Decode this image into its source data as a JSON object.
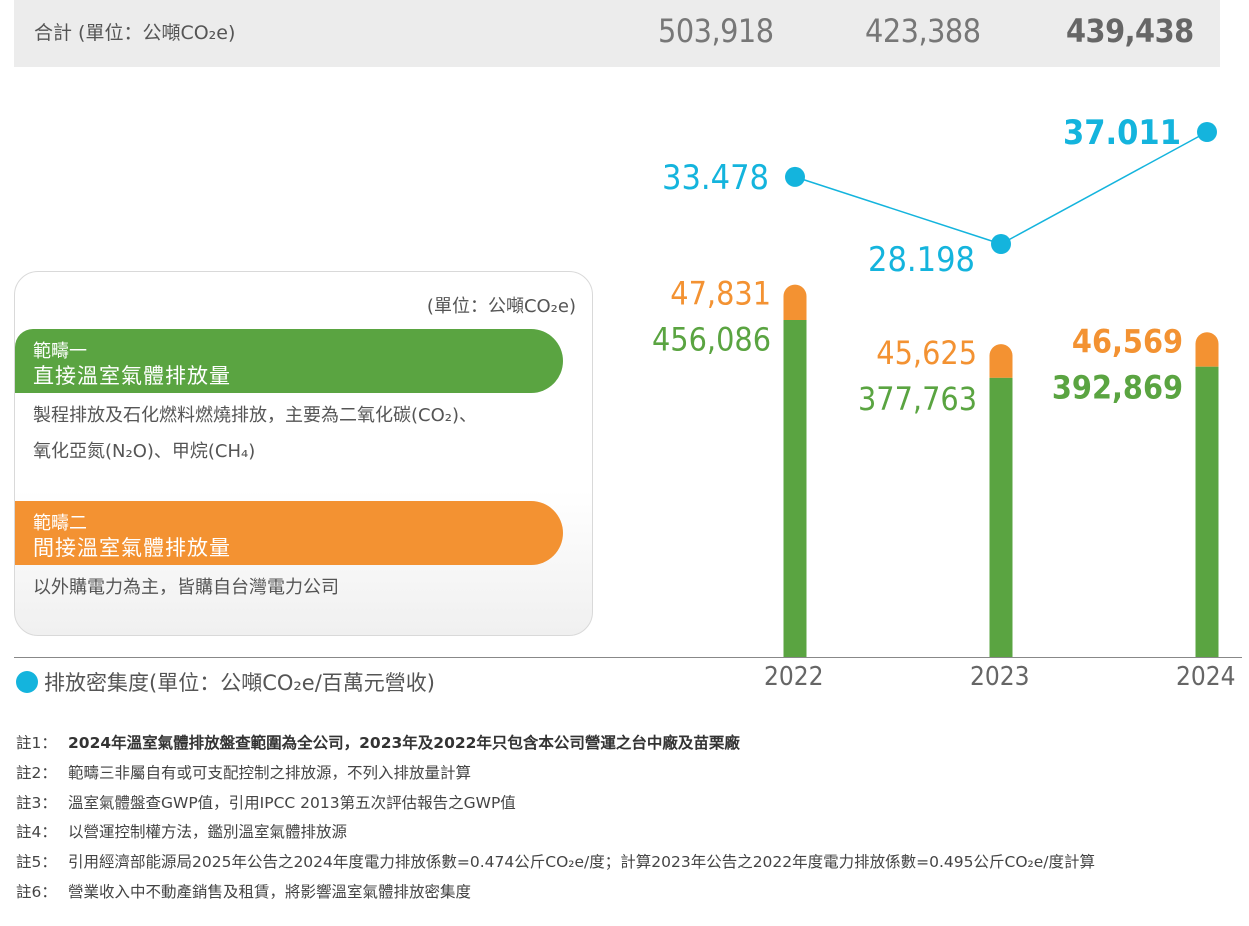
{
  "totals": {
    "label": "合計 (單位：公噸CO₂e)",
    "values": [
      "503,918",
      "423,388",
      "439,438"
    ]
  },
  "legend": {
    "unit": "(單位：公噸CO₂e)",
    "scope1": {
      "line1": "範疇一",
      "line2": "直接溫室氣體排放量",
      "desc1": "製程排放及石化燃料燃燒排放，主要為二氧化碳(CO₂)、",
      "desc2": "氧化亞氮(N₂O)、甲烷(CH₄)"
    },
    "scope2": {
      "line1": "範疇二",
      "line2": "間接溫室氣體排放量",
      "desc1": "以外購電力為主，皆購自台灣電力公司"
    }
  },
  "intensity_legend": "排放密集度(單位：公噸CO₂e/百萬元營收)",
  "colors": {
    "scope1": "#5aa441",
    "scope2": "#f39232",
    "intensity": "#14b4dd"
  },
  "chart_data": {
    "type": "bar",
    "categories": [
      "2022",
      "2023",
      "2024"
    ],
    "series": [
      {
        "name": "範疇一 直接溫室氣體排放量",
        "values": [
          456086,
          377763,
          392869
        ],
        "labels": [
          "456,086",
          "377,763",
          "392,869"
        ]
      },
      {
        "name": "範疇二 間接溫室氣體排放量",
        "values": [
          47831,
          45625,
          46569
        ],
        "labels": [
          "47,831",
          "45,625",
          "46,569"
        ]
      }
    ],
    "line_series": {
      "name": "排放密集度",
      "values": [
        33.478,
        28.198,
        37.011
      ],
      "labels": [
        "33.478",
        "28.198",
        "37.011"
      ]
    }
  },
  "notes": [
    {
      "label": "註1：",
      "text": "2024年溫室氣體排放盤查範圍為全公司，2023年及2022年只包含本公司營運之台中廠及苗栗廠"
    },
    {
      "label": "註2：",
      "text": "範疇三非屬自有或可支配控制之排放源，不列入排放量計算"
    },
    {
      "label": "註3：",
      "text": "溫室氣體盤查GWP值，引用IPCC 2013第五次評估報告之GWP值"
    },
    {
      "label": "註4：",
      "text": "以營運控制權方法，鑑別溫室氣體排放源"
    },
    {
      "label": "註5：",
      "text": "引用經濟部能源局2025年公告之2024年度電力排放係數=0.474公斤CO₂e/度；計算2023年公告之2022年度電力排放係數=0.495公斤CO₂e/度計算"
    },
    {
      "label": "註6：",
      "text": "營業收入中不動產銷售及租賃，將影響溫室氣體排放密集度"
    }
  ]
}
